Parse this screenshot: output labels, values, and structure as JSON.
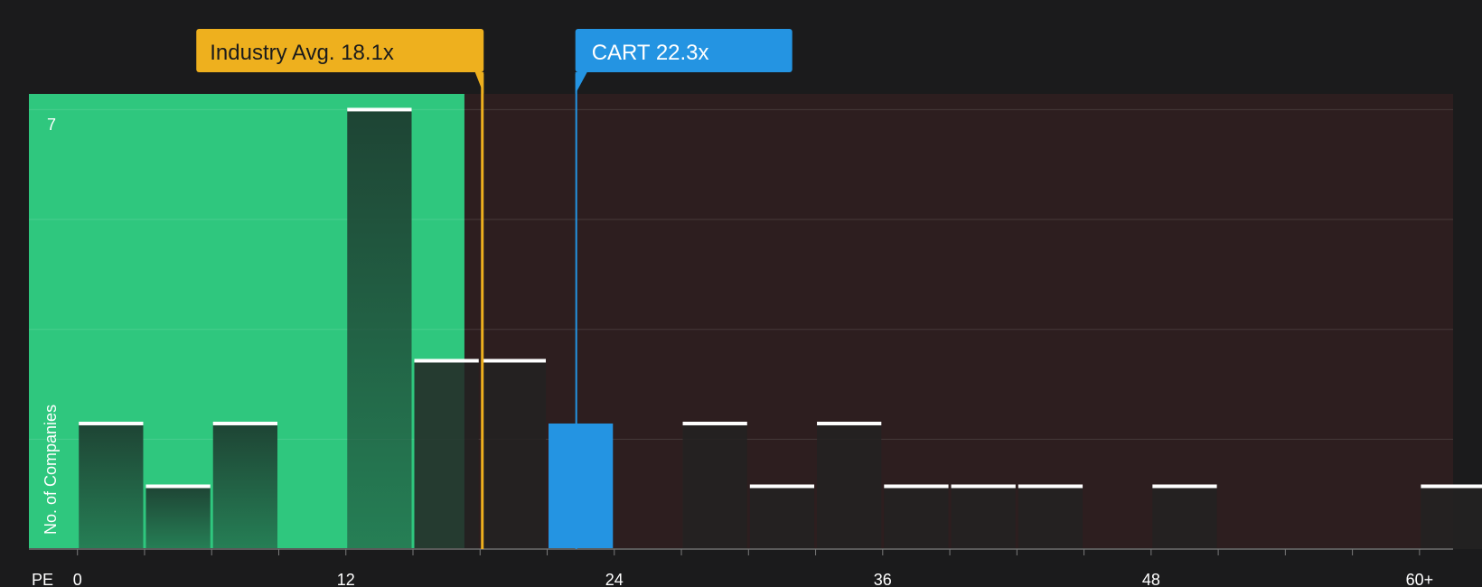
{
  "chart_data": {
    "type": "bar",
    "xlabel": "PE",
    "ylabel": "No. of Companies",
    "x_ticks": [
      "0",
      "12",
      "24",
      "36",
      "48",
      "60+"
    ],
    "x_tick_values": [
      0,
      12,
      24,
      36,
      48,
      60
    ],
    "y_tick_label": "7",
    "xlim": [
      -2.17,
      61.5
    ],
    "ylim": [
      0,
      7.25
    ],
    "bin_width": 3,
    "bars": [
      {
        "x_start": 0,
        "value": 2,
        "highlight": false
      },
      {
        "x_start": 3,
        "value": 1,
        "highlight": false
      },
      {
        "x_start": 6,
        "value": 2,
        "highlight": false
      },
      {
        "x_start": 12,
        "value": 7,
        "highlight": false
      },
      {
        "x_start": 15,
        "value": 3,
        "highlight": false
      },
      {
        "x_start": 18,
        "value": 3,
        "highlight": false
      },
      {
        "x_start": 21,
        "value": 2,
        "highlight": true
      },
      {
        "x_start": 27,
        "value": 2,
        "highlight": false
      },
      {
        "x_start": 30,
        "value": 1,
        "highlight": false
      },
      {
        "x_start": 33,
        "value": 2,
        "highlight": false
      },
      {
        "x_start": 36,
        "value": 1,
        "highlight": false
      },
      {
        "x_start": 39,
        "value": 1,
        "highlight": false
      },
      {
        "x_start": 42,
        "value": 1,
        "highlight": false
      },
      {
        "x_start": 48,
        "value": 1,
        "highlight": false
      },
      {
        "x_start": 60,
        "value": 1,
        "highlight": false
      }
    ],
    "fair_zone_end": 17.3,
    "industry_avg": {
      "label": "Industry Avg. 18.1x",
      "value": 18.1
    },
    "company": {
      "label": "CART 22.3x",
      "value": 22.3
    },
    "grid": true,
    "colors": {
      "background": "#1b1b1c",
      "fair_zone": "#2fc77e",
      "over_zone": "#2d1e1f",
      "bar_dark": "#232222",
      "bar_highlight": "#2494e2",
      "industry_line": "#eeb01e",
      "company_line": "#2494e2"
    }
  }
}
